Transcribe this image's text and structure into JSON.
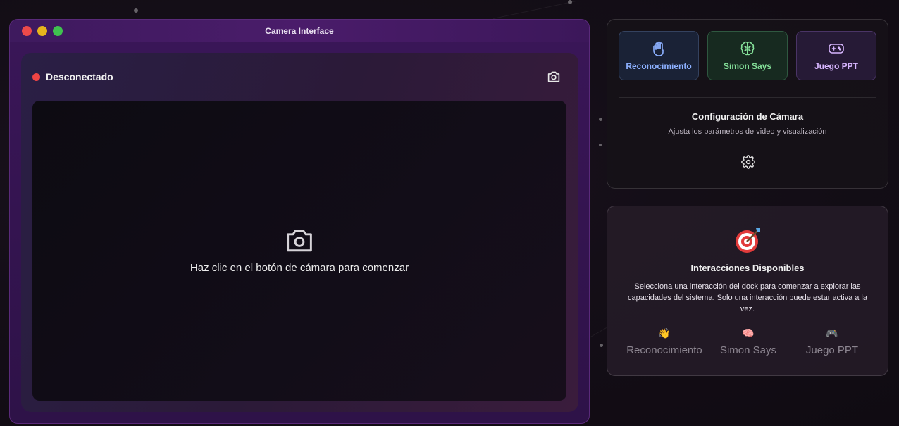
{
  "window": {
    "title": "Camera Interface"
  },
  "camera": {
    "status": "Desconectado",
    "status_color": "#ef4444",
    "placeholder": "Haz clic en el botón de cámara para comenzar"
  },
  "dock": {
    "items": [
      {
        "label": "Reconocimiento",
        "icon": "hand-icon",
        "color": "#8cb0ff"
      },
      {
        "label": "Simon Says",
        "icon": "brain-icon",
        "color": "#86e39b"
      },
      {
        "label": "Juego PPT",
        "icon": "gamepad-icon",
        "color": "#d7b6ff"
      }
    ]
  },
  "config": {
    "title": "Configuración de Cámara",
    "subtitle": "Ajusta los parámetros de video y visualización"
  },
  "interactions": {
    "title": "Interacciones Disponibles",
    "description": "Selecciona una interacción del dock para comenzar a explorar las capacidades del sistema. Solo una interacción puede estar activa a la vez.",
    "items": [
      {
        "emoji": "👋",
        "label": "Reconocimiento"
      },
      {
        "emoji": "🧠",
        "label": "Simon Says"
      },
      {
        "emoji": "🎮",
        "label": "Juego PPT"
      }
    ]
  }
}
